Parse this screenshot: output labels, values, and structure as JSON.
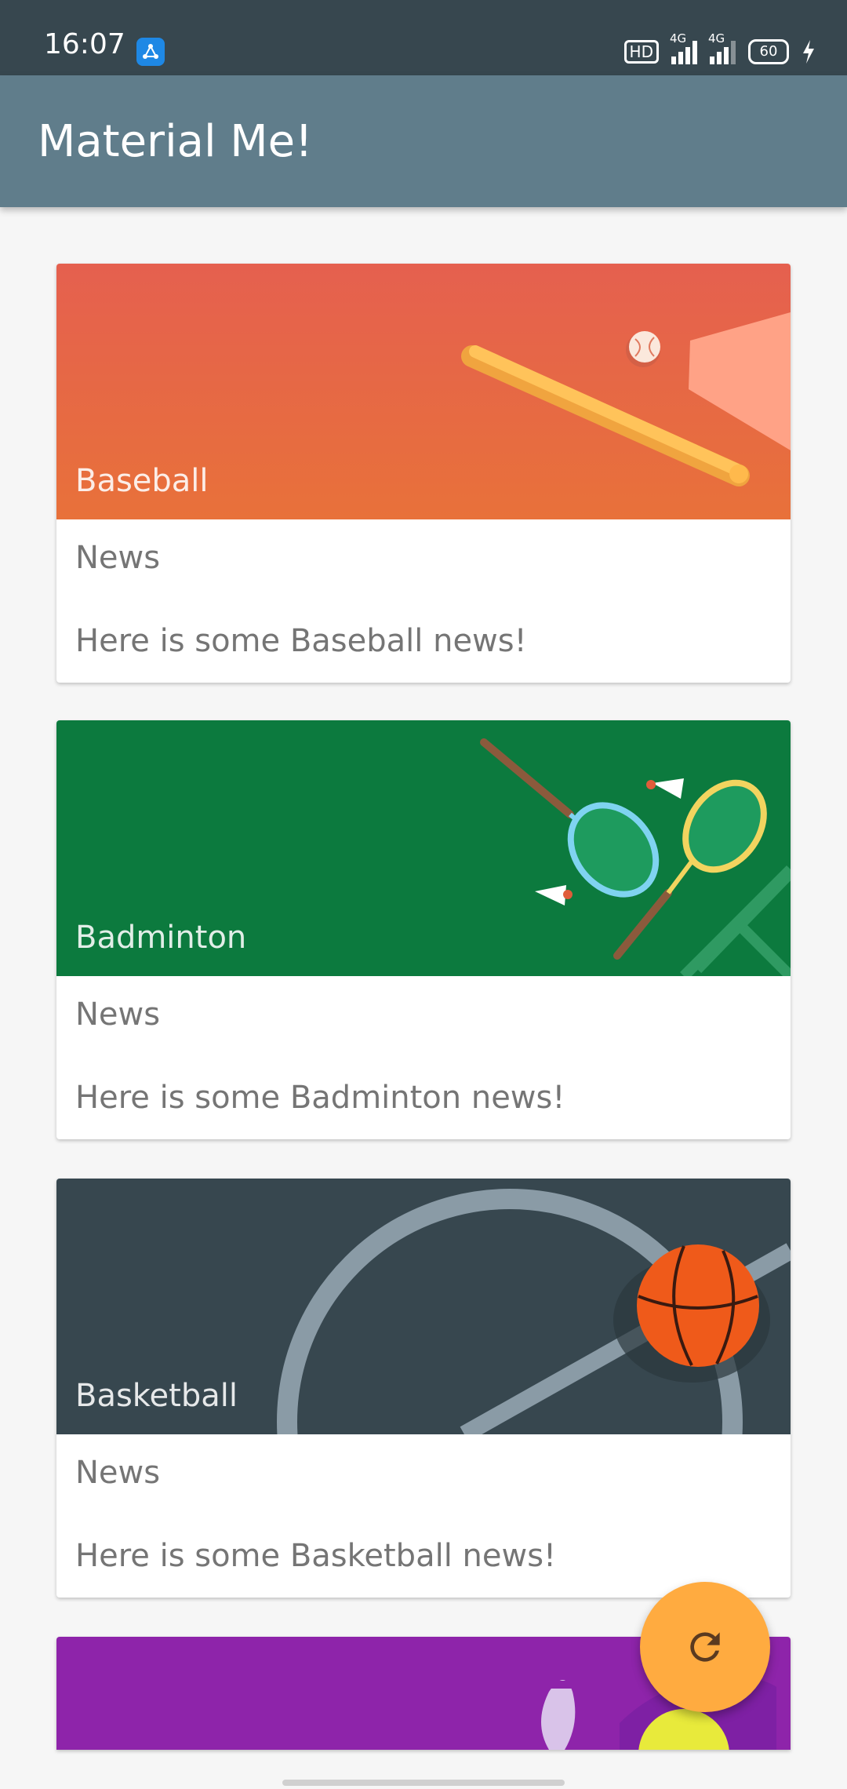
{
  "status_bar": {
    "time": "16:07",
    "hd_label": "HD",
    "network1": "4G",
    "network2": "4G",
    "battery": "60",
    "icons": [
      "app-notification-icon",
      "hd-voice-icon",
      "signal-icon",
      "signal-icon",
      "battery-icon",
      "charging-icon"
    ]
  },
  "app_bar": {
    "title": "Material Me!"
  },
  "cards": [
    {
      "title": "Baseball",
      "subtitle": "News",
      "info": "Here is some Baseball news!",
      "color": "#e8624d"
    },
    {
      "title": "Badminton",
      "subtitle": "News",
      "info": "Here is some Badminton news!",
      "color": "#0c7a3e"
    },
    {
      "title": "Basketball",
      "subtitle": "News",
      "info": "Here is some Basketball news!",
      "color": "#37474f"
    },
    {
      "title": "",
      "subtitle": "",
      "info": "",
      "color": "#8e24aa"
    }
  ],
  "fab": {
    "icon": "refresh-icon",
    "color": "#ffab40"
  }
}
